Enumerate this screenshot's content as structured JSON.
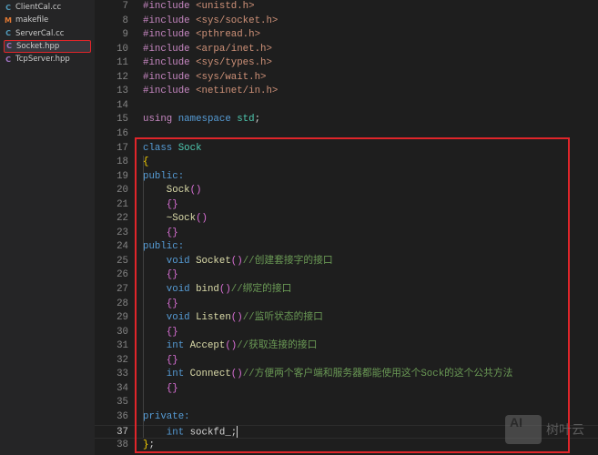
{
  "sidebar": {
    "files": [
      {
        "name": "ClientCal.cc",
        "icon": "C",
        "color": "#519aba"
      },
      {
        "name": "makefile",
        "icon": "M",
        "color": "#e37933"
      },
      {
        "name": "ServerCal.cc",
        "icon": "C",
        "color": "#519aba"
      },
      {
        "name": "Socket.hpp",
        "icon": "C",
        "color": "#a074c4",
        "selected": true
      },
      {
        "name": "TcpServer.hpp",
        "icon": "C",
        "color": "#a074c4"
      }
    ]
  },
  "editor": {
    "current_line": 37,
    "lines": [
      {
        "n": "7",
        "tokens": [
          {
            "t": "#include ",
            "c": "pp"
          },
          {
            "t": "<unistd.h>",
            "c": "str"
          }
        ]
      },
      {
        "n": "8",
        "tokens": [
          {
            "t": "#include ",
            "c": "pp"
          },
          {
            "t": "<sys/socket.h>",
            "c": "str"
          }
        ]
      },
      {
        "n": "9",
        "tokens": [
          {
            "t": "#include ",
            "c": "pp"
          },
          {
            "t": "<pthread.h>",
            "c": "str"
          }
        ]
      },
      {
        "n": "10",
        "tokens": [
          {
            "t": "#include ",
            "c": "pp"
          },
          {
            "t": "<arpa/inet.h>",
            "c": "str"
          }
        ]
      },
      {
        "n": "11",
        "tokens": [
          {
            "t": "#include ",
            "c": "pp"
          },
          {
            "t": "<sys/types.h>",
            "c": "str"
          }
        ]
      },
      {
        "n": "12",
        "tokens": [
          {
            "t": "#include ",
            "c": "pp"
          },
          {
            "t": "<sys/wait.h>",
            "c": "str"
          }
        ]
      },
      {
        "n": "13",
        "tokens": [
          {
            "t": "#include ",
            "c": "pp"
          },
          {
            "t": "<netinet/in.h>",
            "c": "str"
          }
        ]
      },
      {
        "n": "14",
        "tokens": []
      },
      {
        "n": "15",
        "tokens": [
          {
            "t": "using ",
            "c": "pp"
          },
          {
            "t": "namespace ",
            "c": "kw"
          },
          {
            "t": "std",
            "c": "ty"
          },
          {
            "t": ";",
            "c": "pl"
          }
        ]
      },
      {
        "n": "16",
        "tokens": []
      },
      {
        "n": "17",
        "tokens": [
          {
            "t": "class ",
            "c": "kw"
          },
          {
            "t": "Sock",
            "c": "ty"
          }
        ]
      },
      {
        "n": "18",
        "tokens": [
          {
            "t": "{",
            "c": "by"
          }
        ]
      },
      {
        "n": "19",
        "tokens": [
          {
            "t": "public:",
            "c": "kw"
          }
        ]
      },
      {
        "n": "20",
        "tokens": [
          {
            "t": "    Sock",
            "c": "fn"
          },
          {
            "t": "()",
            "c": "br"
          }
        ]
      },
      {
        "n": "21",
        "tokens": [
          {
            "t": "    {}",
            "c": "br"
          }
        ]
      },
      {
        "n": "22",
        "tokens": [
          {
            "t": "    ~Sock",
            "c": "fn"
          },
          {
            "t": "()",
            "c": "br"
          }
        ]
      },
      {
        "n": "23",
        "tokens": [
          {
            "t": "    {}",
            "c": "br"
          }
        ]
      },
      {
        "n": "24",
        "tokens": [
          {
            "t": "public:",
            "c": "kw"
          }
        ]
      },
      {
        "n": "25",
        "tokens": [
          {
            "t": "    void ",
            "c": "kw"
          },
          {
            "t": "Socket",
            "c": "fn"
          },
          {
            "t": "()",
            "c": "br"
          },
          {
            "t": "//创建套接字的接口",
            "c": "cm"
          }
        ]
      },
      {
        "n": "26",
        "tokens": [
          {
            "t": "    {}",
            "c": "br"
          }
        ]
      },
      {
        "n": "27",
        "tokens": [
          {
            "t": "    void ",
            "c": "kw"
          },
          {
            "t": "bind",
            "c": "fn"
          },
          {
            "t": "()",
            "c": "br"
          },
          {
            "t": "//绑定的接口",
            "c": "cm"
          }
        ]
      },
      {
        "n": "28",
        "tokens": [
          {
            "t": "    {}",
            "c": "br"
          }
        ]
      },
      {
        "n": "29",
        "tokens": [
          {
            "t": "    void ",
            "c": "kw"
          },
          {
            "t": "Listen",
            "c": "fn"
          },
          {
            "t": "()",
            "c": "br"
          },
          {
            "t": "//监听状态的接口",
            "c": "cm"
          }
        ]
      },
      {
        "n": "30",
        "tokens": [
          {
            "t": "    {}",
            "c": "br"
          }
        ]
      },
      {
        "n": "31",
        "tokens": [
          {
            "t": "    int ",
            "c": "kw"
          },
          {
            "t": "Accept",
            "c": "fn"
          },
          {
            "t": "()",
            "c": "br"
          },
          {
            "t": "//获取连接的接口",
            "c": "cm"
          }
        ]
      },
      {
        "n": "32",
        "tokens": [
          {
            "t": "    {}",
            "c": "br"
          }
        ]
      },
      {
        "n": "33",
        "tokens": [
          {
            "t": "    int ",
            "c": "kw"
          },
          {
            "t": "Connect",
            "c": "fn"
          },
          {
            "t": "()",
            "c": "br"
          },
          {
            "t": "//方便两个客户端和服务器都能使用这个Sock的这个公共方法",
            "c": "cm"
          }
        ]
      },
      {
        "n": "34",
        "tokens": [
          {
            "t": "    {}",
            "c": "br"
          }
        ]
      },
      {
        "n": "35",
        "tokens": []
      },
      {
        "n": "36",
        "tokens": [
          {
            "t": "private:",
            "c": "kw"
          }
        ]
      },
      {
        "n": "37",
        "tokens": [
          {
            "t": "    int ",
            "c": "kw"
          },
          {
            "t": "sockfd_",
            "c": "pl"
          },
          {
            "t": ";",
            "c": "pl"
          }
        ]
      },
      {
        "n": "38",
        "tokens": [
          {
            "t": "}",
            "c": "by"
          },
          {
            "t": ";",
            "c": "pl"
          }
        ]
      }
    ]
  },
  "watermark": {
    "logo": "AI",
    "text": "树叶云"
  }
}
